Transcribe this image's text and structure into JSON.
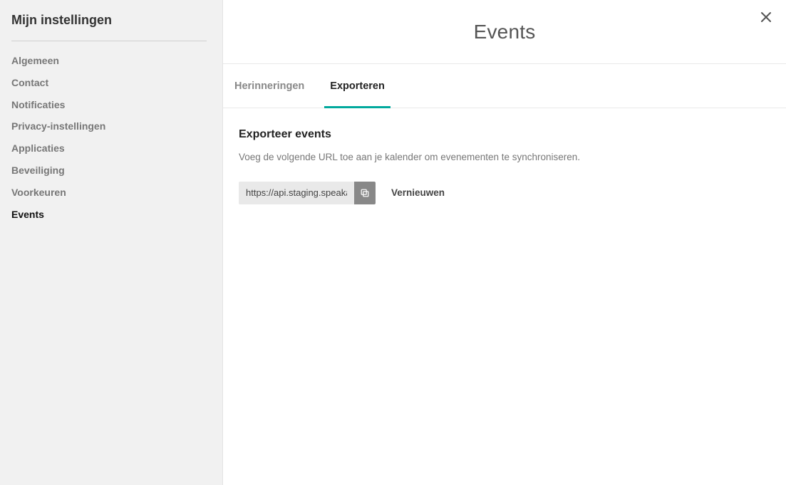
{
  "sidebar": {
    "title": "Mijn instellingen",
    "items": [
      {
        "label": "Algemeen",
        "name": "sidebar-item-algemeen",
        "active": false
      },
      {
        "label": "Contact",
        "name": "sidebar-item-contact",
        "active": false
      },
      {
        "label": "Notificaties",
        "name": "sidebar-item-notificaties",
        "active": false
      },
      {
        "label": "Privacy-instellingen",
        "name": "sidebar-item-privacy",
        "active": false
      },
      {
        "label": "Applicaties",
        "name": "sidebar-item-applicaties",
        "active": false
      },
      {
        "label": "Beveiliging",
        "name": "sidebar-item-beveiliging",
        "active": false
      },
      {
        "label": "Voorkeuren",
        "name": "sidebar-item-voorkeuren",
        "active": false
      },
      {
        "label": "Events",
        "name": "sidebar-item-events",
        "active": true
      }
    ]
  },
  "header": {
    "title": "Events"
  },
  "tabs": [
    {
      "label": "Herinneringen",
      "name": "tab-herinneringen",
      "active": false
    },
    {
      "label": "Exporteren",
      "name": "tab-exporteren",
      "active": true
    }
  ],
  "export": {
    "title": "Exporteer events",
    "description": "Voeg de volgende URL toe aan je kalender om evenementen te synchroniseren.",
    "url_value": "https://api.staging.speaka",
    "refresh_label": "Vernieuwen"
  },
  "colors": {
    "accent": "#00a99d"
  }
}
